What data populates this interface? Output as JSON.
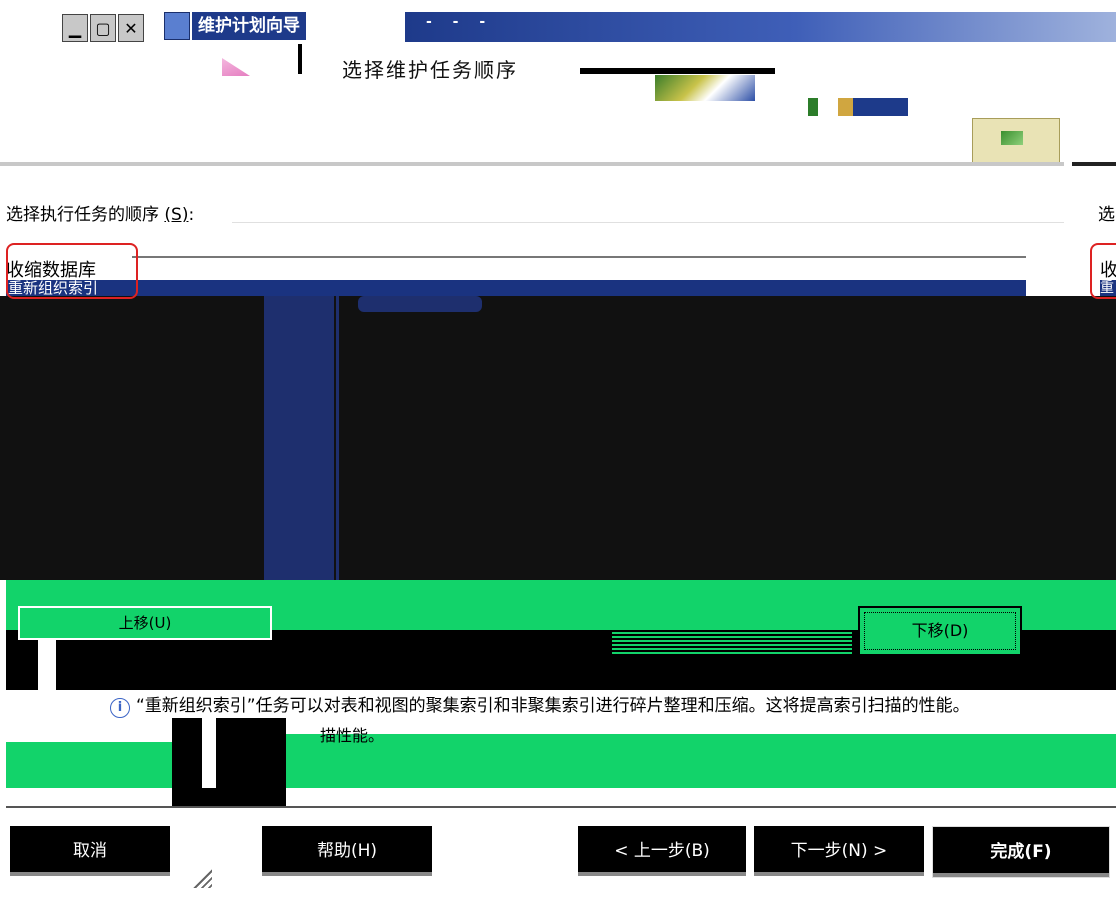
{
  "window": {
    "title": "维护计划向导",
    "dashes": "- - -"
  },
  "header": {
    "title": "选择维护任务顺序"
  },
  "order_section": {
    "label": "选择执行任务的顺序",
    "accel": "(S)",
    "colon": ":",
    "right_label_cut": "选"
  },
  "task_list": {
    "items": [
      "收缩数据库",
      "重新组织索引"
    ],
    "right_items": [
      "收",
      "重"
    ]
  },
  "buttons": {
    "move_up": "上移(U)",
    "move_down": "下移(D)"
  },
  "info": {
    "icon": "i",
    "message": "“重新组织索引”任务可以对表和视图的聚集索引和非聚集索引进行碎片整理和压缩。这将提高索引扫描的性能。",
    "second_line": "描性能。"
  },
  "footer": {
    "cancel": "取消",
    "help": "帮助(H)",
    "back": "< 上一步(B)",
    "next": "下一步(N) >",
    "finish": "完成(F)"
  }
}
